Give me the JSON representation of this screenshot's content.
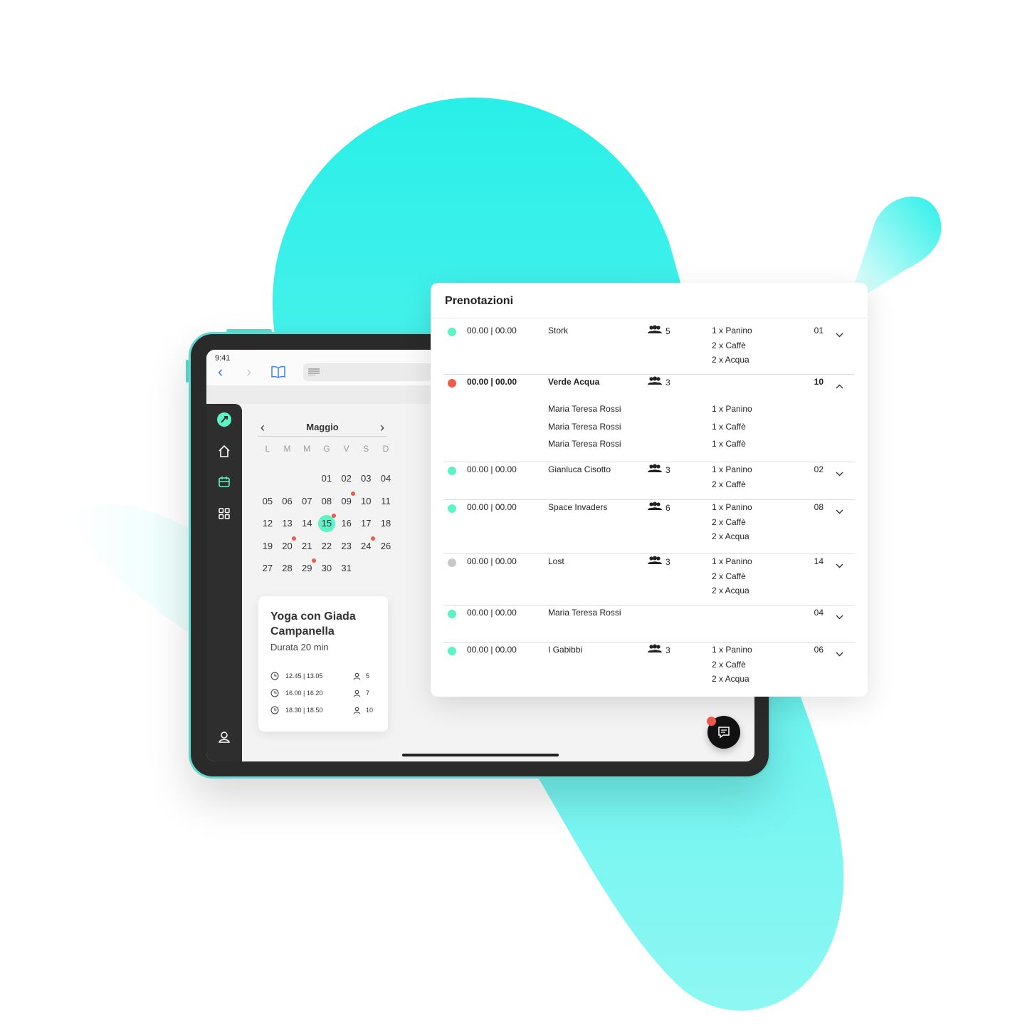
{
  "colors": {
    "accent": "#2af0e8",
    "green": "#5ef2c7",
    "red": "#ef5b4b",
    "gray": "#c8c8c8"
  },
  "tablet": {
    "status_time": "9:41",
    "icons": {
      "back": "chevron-left-icon",
      "forward": "chevron-right-icon",
      "reader": "book-icon",
      "url": "lines-icon"
    }
  },
  "sidebar": {
    "items": [
      {
        "name": "logo",
        "icon": "leaf-logo-icon"
      },
      {
        "name": "home",
        "icon": "home-icon"
      },
      {
        "name": "calendar",
        "icon": "calendar-icon"
      },
      {
        "name": "apps",
        "icon": "grid-icon"
      },
      {
        "name": "profile",
        "icon": "user-icon"
      }
    ]
  },
  "calendar": {
    "month": "Maggio",
    "weekdays": [
      "L",
      "M",
      "M",
      "G",
      "V",
      "S",
      "D"
    ],
    "leading_blanks": 3,
    "days": [
      "01",
      "02",
      "03",
      "04",
      "05",
      "06",
      "07",
      "08",
      "09",
      "10",
      "11",
      "12",
      "13",
      "14",
      "15",
      "16",
      "17",
      "18",
      "19",
      "20",
      "21",
      "22",
      "23",
      "24",
      "26",
      "27",
      "28",
      "29",
      "30",
      "31"
    ],
    "selected": "15",
    "marked": [
      "09",
      "15",
      "20",
      "24",
      "29"
    ]
  },
  "event_card": {
    "title": "Yoga con Giada Campanella",
    "duration": "Durata 20 min",
    "slots": [
      {
        "time": "12.45 | 13.05",
        "people": "5"
      },
      {
        "time": "16.00 | 16.20",
        "people": "7"
      },
      {
        "time": "18.30 | 18.50",
        "people": "10"
      }
    ]
  },
  "bookings": {
    "title": "Prenotazioni",
    "rows": [
      {
        "status": "green",
        "time": "00.00 | 00.00",
        "name": "Stork",
        "guests": "5",
        "orders": [
          "1 x Panino",
          "2 x Caffè",
          "2 x Acqua"
        ],
        "table": "01",
        "expanded": false
      },
      {
        "status": "red",
        "time": "00.00 | 00.00",
        "name": "Verde Acqua",
        "guests": "3",
        "orders": [],
        "table": "10",
        "expanded": true,
        "details": [
          {
            "person": "Maria Teresa Rossi",
            "order": "1 x Panino"
          },
          {
            "person": "Maria Teresa Rossi",
            "order": "1 x Caffè"
          },
          {
            "person": "Maria Teresa Rossi",
            "order": "1 x Caffè"
          }
        ]
      },
      {
        "status": "green",
        "time": "00.00 | 00.00",
        "name": "Gianluca Cisotto",
        "guests": "3",
        "orders": [
          "1 x Panino",
          "2 x Caffè"
        ],
        "table": "02",
        "expanded": false
      },
      {
        "status": "green",
        "time": "00.00 | 00.00",
        "name": "Space Invaders",
        "guests": "6",
        "orders": [
          "1 x Panino",
          "2 x Caffè",
          "2 x Acqua"
        ],
        "table": "08",
        "expanded": false
      },
      {
        "status": "gray",
        "time": "00.00 | 00.00",
        "name": "Lost",
        "guests": "3",
        "orders": [
          "1 x Panino",
          "2 x Caffè",
          "2 x Acqua"
        ],
        "table": "14",
        "expanded": false
      },
      {
        "status": "green",
        "time": "00.00 | 00.00",
        "name": "Maria Teresa Rossi",
        "guests": "",
        "orders": [],
        "table": "04",
        "expanded": false
      },
      {
        "status": "green",
        "time": "00.00 | 00.00",
        "name": "I Gabibbi",
        "guests": "3",
        "orders": [
          "1 x Panino",
          "2 x Caffè",
          "2 x Acqua"
        ],
        "table": "06",
        "expanded": false
      }
    ]
  }
}
